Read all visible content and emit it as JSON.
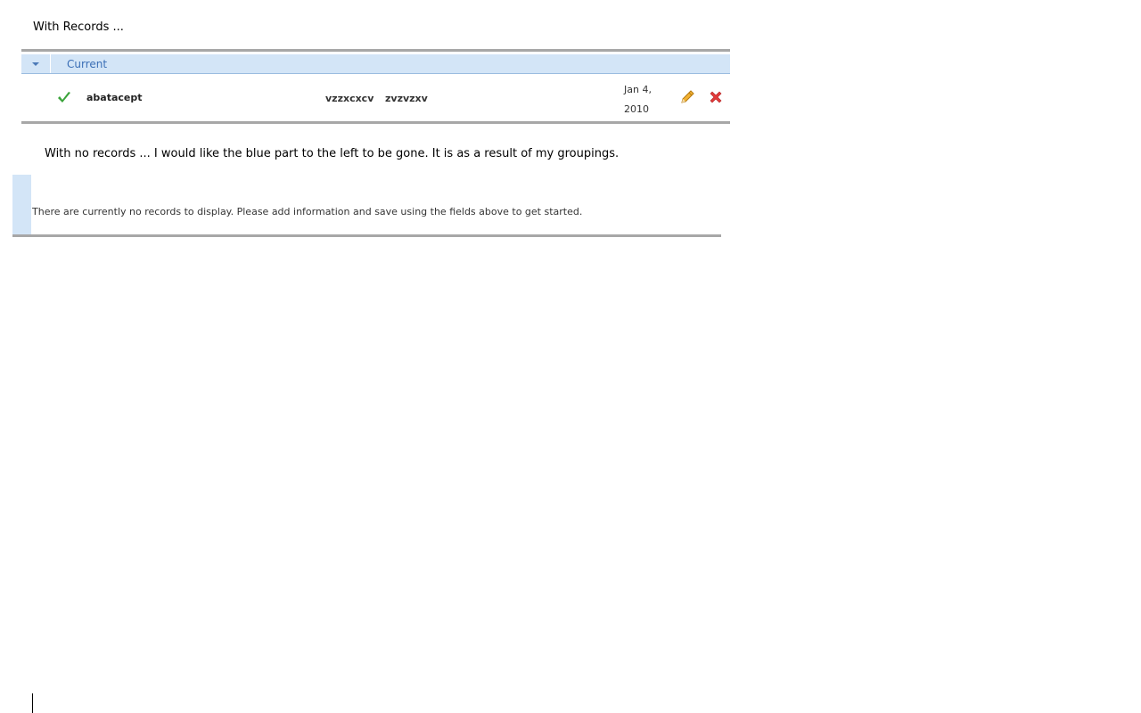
{
  "captions": {
    "with_records": "With Records ...",
    "no_records": "With no records ... I would like the blue part to the left to be gone.  It is as a result of my groupings."
  },
  "grid_with_records": {
    "group": {
      "label": "Current",
      "toggle_icon": "collapse-triangle-icon"
    },
    "rows": [
      {
        "status_icon": "check-icon",
        "name": "abatacept",
        "field3": "vzzxcxcv",
        "field4": "zvzvzxv",
        "date_line1": "Jan 4,",
        "date_line2": "2010",
        "edit_icon": "pencil-icon",
        "delete_icon": "close-x-icon"
      }
    ]
  },
  "grid_no_records": {
    "empty_message": "There are currently no records to display. Please add information and save using the fields above to get started."
  },
  "colors": {
    "group_header_bg": "#d3e5f7",
    "group_label": "#3b6fb6",
    "grid_border": "#a7a7a7",
    "check_green": "#3aa33a",
    "delete_red": "#e23b3b",
    "pencil_orange": "#e8a21c"
  }
}
